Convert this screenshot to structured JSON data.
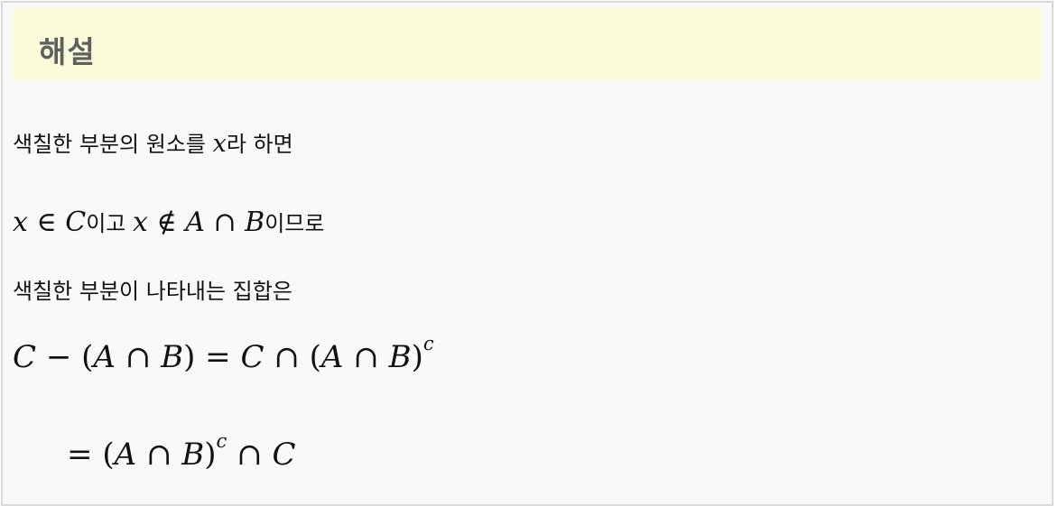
{
  "header": {
    "title": "해설"
  },
  "lines": {
    "l1_pre": "색칠한 부분의 원소를 ",
    "l1_var": "x",
    "l1_post": "라 하면",
    "l2": {
      "x1": "x",
      "in": "∈",
      "C": "C",
      "t1": "이고 ",
      "x2": "x",
      "notin": "∉",
      "A": "A",
      "cap": "∩",
      "B": "B",
      "t2": "이므로"
    },
    "l3": "색칠한 부분이 나타내는 집합은",
    "l4": {
      "C1": "C",
      "minus": "−",
      "lp1": "(",
      "A1": "A",
      "cap1": "∩",
      "B1": "B",
      "rp1": ")",
      "eq": "=",
      "C2": "C",
      "cap2": "∩",
      "lp2": "(",
      "A2": "A",
      "cap3": "∩",
      "B2": "B",
      "rp2": ")",
      "c": "c"
    },
    "l5": {
      "eq": "=",
      "lp": "(",
      "A": "A",
      "cap1": "∩",
      "B": "B",
      "rp": ")",
      "c": "c",
      "cap2": "∩",
      "C": "C"
    }
  }
}
